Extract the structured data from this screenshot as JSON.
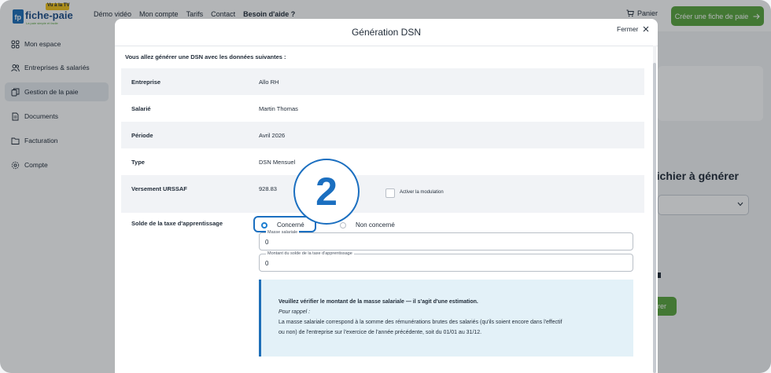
{
  "topbar": {
    "logo_badge": "Vu à la TV",
    "logo_text": "fiche-paie",
    "logo_tagline": "La paie simple et facile",
    "nav": [
      "Démo vidéo",
      "Mon compte",
      "Tarifs",
      "Contact",
      "Besoin d'aide ?"
    ],
    "cart_label": "Panier",
    "cta_label": "Créer une fiche de paie"
  },
  "sidebar": {
    "items": [
      {
        "label": "Mon espace",
        "icon": "grid-icon"
      },
      {
        "label": "Entreprises & salariés",
        "icon": "users-icon"
      },
      {
        "label": "Gestion de la paie",
        "icon": "copy-icon",
        "active": true
      },
      {
        "label": "Documents",
        "icon": "document-icon"
      },
      {
        "label": "Facturation",
        "icon": "folder-icon"
      },
      {
        "label": "Compte",
        "icon": "gear-icon"
      }
    ]
  },
  "background": {
    "section_title": "fichier à générer",
    "button_label": "rer"
  },
  "modal": {
    "title": "Génération DSN",
    "close_label": "Fermer",
    "intro": "Vous allez générer une DSN avec les données suivantes :",
    "rows": [
      {
        "label": "Entreprise",
        "value": "Allo RH"
      },
      {
        "label": "Salarié",
        "value": "Martin Thomas"
      },
      {
        "label": "Période",
        "value": "Avril 2026"
      },
      {
        "label": "Type",
        "value": "DSN Mensuel"
      },
      {
        "label": "Versement URSSAF",
        "value": "928.83"
      }
    ],
    "modulation_label": "Activer la modulation",
    "solde_label": "Solde de la taxe d'apprentissage",
    "radio_concerne": "Concerné",
    "radio_non_concerne": "Non concerné",
    "field_masse_legend": "Masse salariale",
    "field_masse_value": "0",
    "field_montant_legend": "Montant du solde de la taxe d'apprentissage",
    "field_montant_value": "0",
    "info": {
      "heading": "Veuillez vérifier le montant de la masse salariale — il s'agit d'une estimation.",
      "reminder": "Pour rappel :",
      "body_line1": "La masse salariale correspond à la somme des rémunérations brutes des salariés (qu'ils soient encore dans l'effectif",
      "body_line2": "ou non) de l'entreprise sur l'exercice de l'année précédente, soit du 01/01 au 31/12."
    }
  },
  "step_badge": "2",
  "colors": {
    "accent": "#1b6fc0",
    "cta": "#5aa53f",
    "info_bg": "#e3f1f8"
  }
}
